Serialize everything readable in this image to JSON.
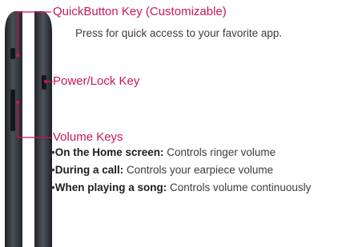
{
  "colors": {
    "accent": "#c8175a",
    "device_body": "#2f3236",
    "text": "#3c3c3c"
  },
  "callouts": {
    "quickbutton": {
      "title": "QuickButton Key (Customizable)",
      "description": "Press for quick access to your favorite app."
    },
    "power": {
      "title": "Power/Lock Key"
    },
    "volume": {
      "title": "Volume Keys",
      "bullets": [
        {
          "bold": "On the Home screen:",
          "text": " Controls ringer volume"
        },
        {
          "bold": "During a call:",
          "text": " Controls your earpiece volume"
        },
        {
          "bold": "When playing a song:",
          "text": " Controls volume continuously"
        }
      ]
    }
  }
}
